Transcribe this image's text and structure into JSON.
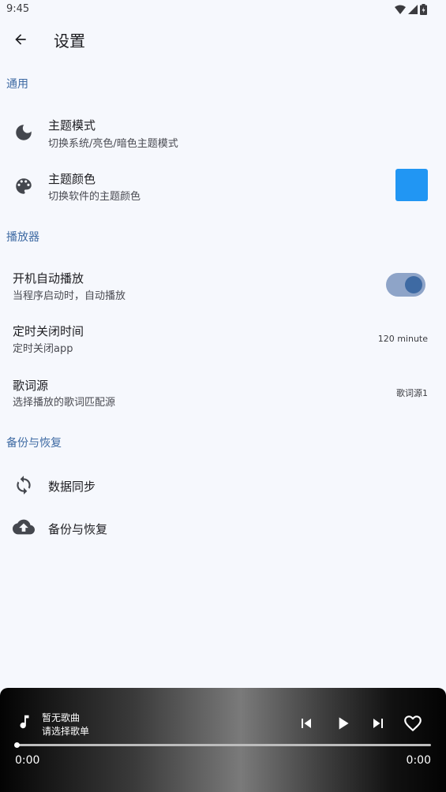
{
  "status_bar": {
    "time": "9:45",
    "icons": [
      "wifi-icon",
      "cell-signal-icon",
      "battery-icon"
    ]
  },
  "app_bar": {
    "title": "设置",
    "back_icon": "arrow-back-icon"
  },
  "sections": {
    "general": {
      "header": "通用",
      "theme_mode": {
        "title": "主题模式",
        "subtitle": "切换系统/亮色/暗色主题模式",
        "icon": "moon-icon"
      },
      "theme_color": {
        "title": "主题颜色",
        "subtitle": "切换软件的主题颜色",
        "icon": "palette-icon",
        "color": "#2196F3"
      }
    },
    "player": {
      "header": "播放器",
      "autoplay": {
        "title": "开机自动播放",
        "subtitle": "当程序启动时，自动播放",
        "enabled": true
      },
      "timer": {
        "title": "定时关闭时间",
        "subtitle": "定时关闭app",
        "value": "120 minute"
      },
      "lyrics": {
        "title": "歌词源",
        "subtitle": "选择播放的歌词匹配源",
        "value": "歌词源1"
      }
    },
    "backup": {
      "header": "备份与恢复",
      "sync": {
        "title": "数据同步",
        "icon": "sync-icon"
      },
      "restore": {
        "title": "备份与恢复",
        "icon": "cloud-upload-icon"
      }
    }
  },
  "mini_player": {
    "song": "暂无歌曲",
    "hint": "请选择歌单",
    "current_time": "0:00",
    "total_time": "0:00",
    "progress": 0,
    "icons": [
      "music-note-icon",
      "skip-previous-icon",
      "play-icon",
      "skip-next-icon",
      "heart-outline-icon"
    ]
  },
  "colors": {
    "accent": "#3E6AA3",
    "background": "#F6F8FD",
    "theme_swatch": "#2196F3"
  }
}
